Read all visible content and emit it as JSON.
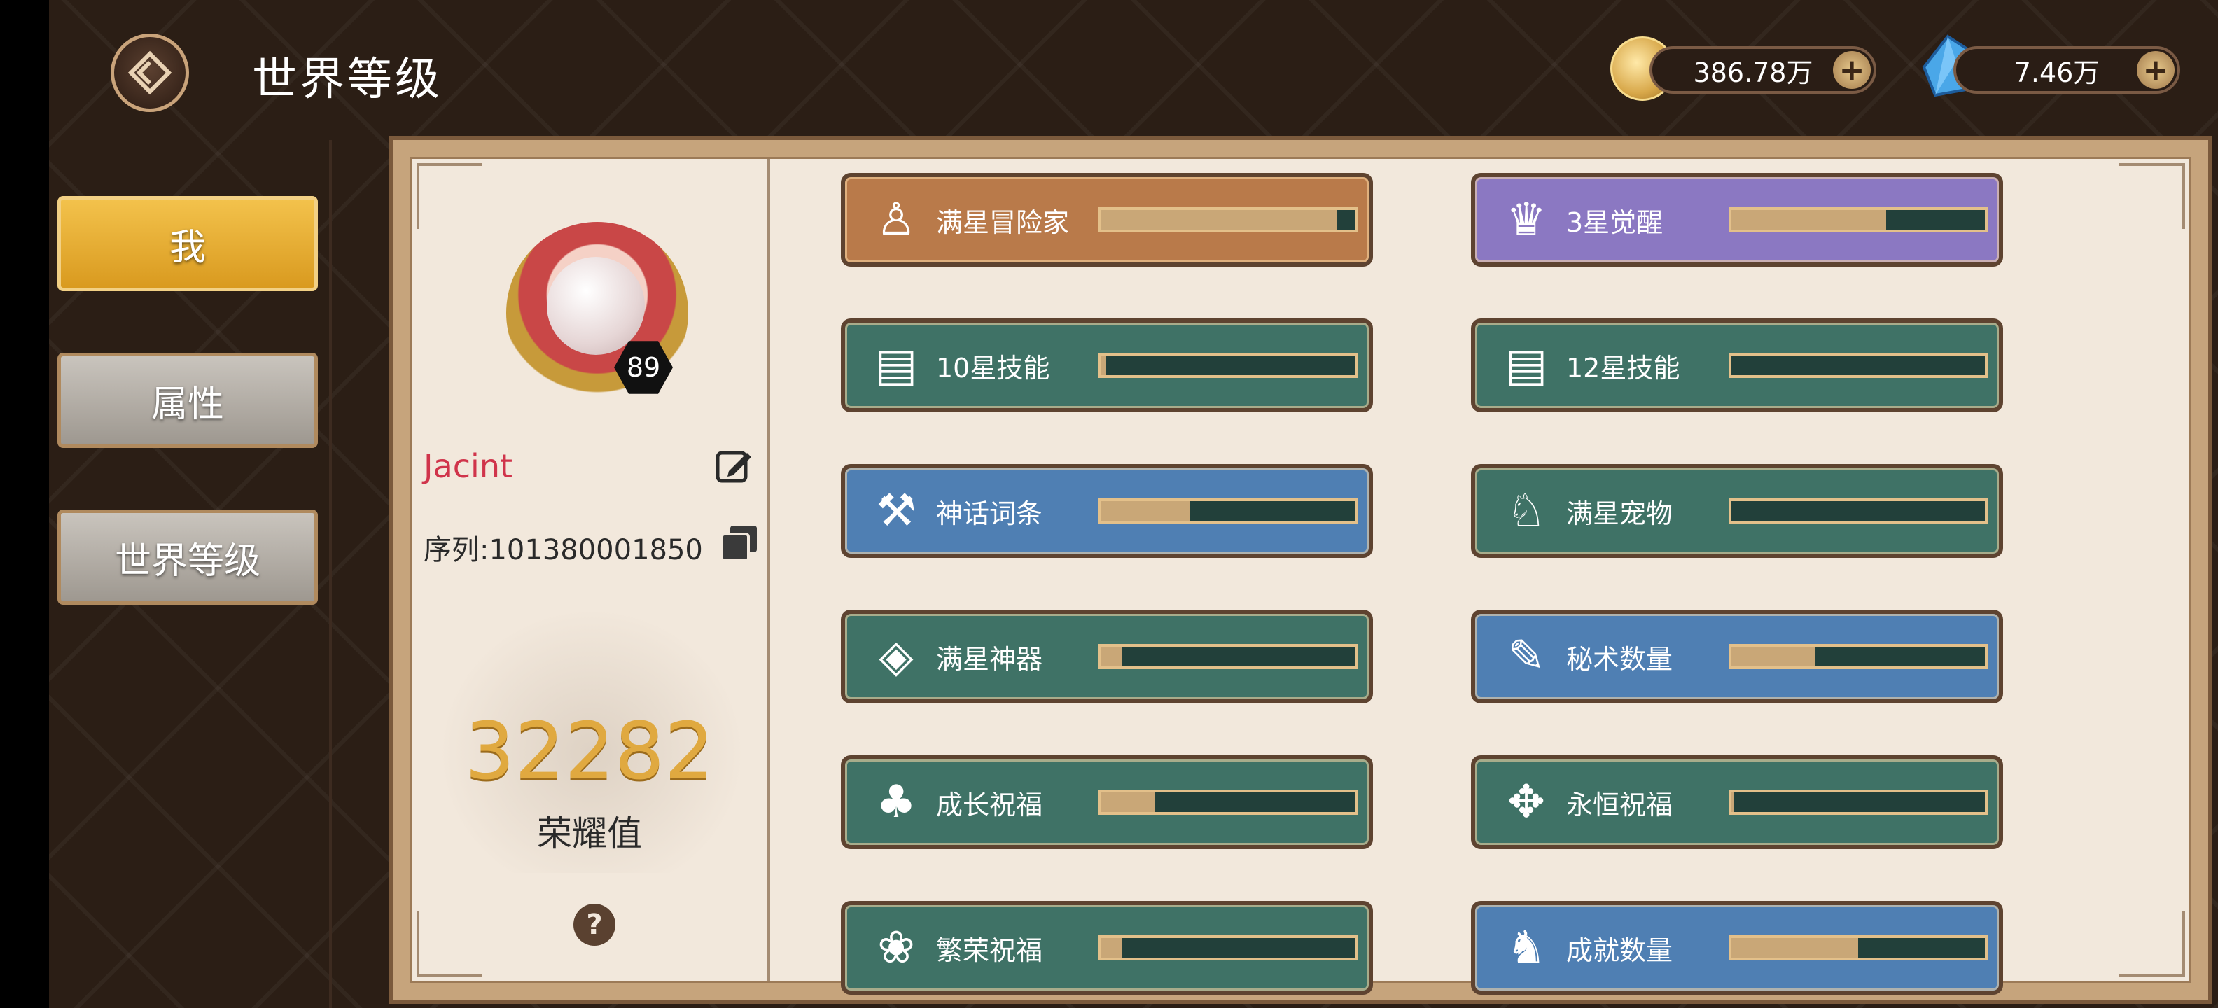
{
  "header": {
    "title": "世界等级",
    "gold": {
      "value": "386.78万",
      "icon": "gold-coin-icon"
    },
    "gems": {
      "value": "7.46万",
      "icon": "blue-crystal-icon"
    }
  },
  "sidebar": {
    "items": [
      {
        "label": "我",
        "active": true
      },
      {
        "label": "属性",
        "active": false
      },
      {
        "label": "世界等级",
        "active": false
      }
    ]
  },
  "profile": {
    "level": "89",
    "name": "Jacint",
    "serial": "序列:101380001850",
    "honor_value": "32282",
    "honor_label": "荣耀值"
  },
  "stats": [
    {
      "label": "满星冒险家",
      "progress": 0.93,
      "color": "brown",
      "icon": "hooded-person-icon"
    },
    {
      "label": "3星觉醒",
      "progress": 0.61,
      "color": "purple",
      "icon": "woman-portrait-icon"
    },
    {
      "label": "10星技能",
      "progress": 0.02,
      "color": "green",
      "icon": "skill-book-icon"
    },
    {
      "label": "12星技能",
      "progress": 0.0,
      "color": "green",
      "icon": "skill-book-icon"
    },
    {
      "label": "神话词条",
      "progress": 0.35,
      "color": "blue",
      "icon": "hammer-icon"
    },
    {
      "label": "满星宠物",
      "progress": 0.0,
      "color": "green",
      "icon": "rabbit-pet-icon"
    },
    {
      "label": "满星神器",
      "progress": 0.08,
      "color": "green",
      "icon": "artifact-crystal-icon"
    },
    {
      "label": "秘术数量",
      "progress": 0.33,
      "color": "blue",
      "icon": "scroll-icon"
    },
    {
      "label": "成长祝福",
      "progress": 0.21,
      "color": "green",
      "icon": "tree-icon"
    },
    {
      "label": "永恒祝福",
      "progress": 0.01,
      "color": "green",
      "icon": "eternal-sigil-icon"
    },
    {
      "label": "繁荣祝福",
      "progress": 0.08,
      "color": "green",
      "icon": "lotus-icon"
    },
    {
      "label": "成就数量",
      "progress": 0.5,
      "color": "blue",
      "icon": "deer-head-icon"
    }
  ]
}
